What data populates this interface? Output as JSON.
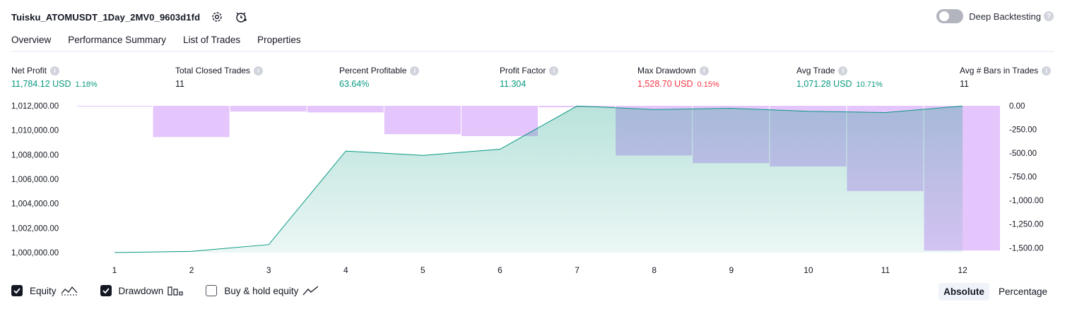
{
  "header": {
    "title": "Tuisku_ATOMUSDT_1Day_2MV0_9603d1fd",
    "settings_icon": "gear-icon",
    "alert_icon": "add-alert-icon"
  },
  "deep_backtesting": {
    "label": "Deep Backtesting",
    "enabled": false,
    "help": "?"
  },
  "tabs": [
    {
      "label": "Overview",
      "active": true
    },
    {
      "label": "Performance Summary",
      "active": false
    },
    {
      "label": "List of Trades",
      "active": false
    },
    {
      "label": "Properties",
      "active": false
    }
  ],
  "metrics": [
    {
      "label": "Net Profit",
      "value": "11,784.12 USD",
      "pct": "1.18%",
      "color": "#089981"
    },
    {
      "label": "Total Closed Trades",
      "value": "11",
      "pct": "",
      "color": "#131722"
    },
    {
      "label": "Percent Profitable",
      "value": "63.64%",
      "pct": "",
      "color": "#089981"
    },
    {
      "label": "Profit Factor",
      "value": "11.304",
      "pct": "",
      "color": "#089981"
    },
    {
      "label": "Max Drawdown",
      "value": "1,528.70 USD",
      "pct": "0.15%",
      "color": "#f23645"
    },
    {
      "label": "Avg Trade",
      "value": "1,071.28 USD",
      "pct": "10.71%",
      "color": "#089981"
    },
    {
      "label": "Avg # Bars in Trades",
      "value": "11",
      "pct": "",
      "color": "#131722"
    }
  ],
  "metric_info_icon": "i",
  "chart_data": {
    "type": "line",
    "x": [
      1,
      2,
      3,
      4,
      5,
      6,
      7,
      8,
      9,
      10,
      11,
      12
    ],
    "x_tick_labels": [
      "1",
      "2",
      "3",
      "4",
      "5",
      "6",
      "7",
      "8",
      "9",
      "10",
      "11",
      "12"
    ],
    "left_axis": {
      "ylim": [
        1000000,
        1012000
      ],
      "tick_labels": [
        "1,012,000.00",
        "1,010,000.00",
        "1,008,000.00",
        "1,006,000.00",
        "1,004,000.00",
        "1,002,000.00",
        "1,000,000.00"
      ],
      "tick_values": [
        1012000,
        1010000,
        1008000,
        1006000,
        1004000,
        1002000,
        1000000
      ]
    },
    "right_axis": {
      "ylim": [
        -1550,
        0
      ],
      "tick_labels": [
        "0.00",
        "-250.00",
        "-500.00",
        "-750.00",
        "-1,000.00",
        "-1,250.00",
        "-1,500.00"
      ],
      "tick_values": [
        0,
        -250,
        -500,
        -750,
        -1000,
        -1250,
        -1500
      ]
    },
    "series": [
      {
        "name": "Equity",
        "axis": "left",
        "color": "#089981",
        "values": [
          1000000,
          1000100,
          1000650,
          1008300,
          1007950,
          1008450,
          1011980,
          1011700,
          1011800,
          1011550,
          1011450,
          1011980
        ]
      },
      {
        "name": "Drawdown",
        "axis": "right",
        "color": "#e1bcfc",
        "x": [
          0.5,
          1.5,
          2.5,
          3.5,
          4.5,
          5.5,
          6.5,
          7.5,
          8.5,
          9.5,
          10.5,
          11.5,
          12.5
        ],
        "values": [
          -5,
          -330,
          -60,
          -70,
          -300,
          -320,
          -15,
          -525,
          -605,
          -640,
          -900,
          -1528.7,
          -1528.7
        ]
      }
    ],
    "grid": false
  },
  "legend": [
    {
      "label": "Equity",
      "checked": true,
      "icon": "equity-line-icon"
    },
    {
      "label": "Drawdown",
      "checked": true,
      "icon": "drawdown-bars-icon"
    },
    {
      "label": "Buy & hold equity",
      "checked": false,
      "icon": "buy-hold-line-icon"
    }
  ],
  "modes": [
    {
      "label": "Absolute",
      "active": true
    },
    {
      "label": "Percentage",
      "active": false
    }
  ]
}
